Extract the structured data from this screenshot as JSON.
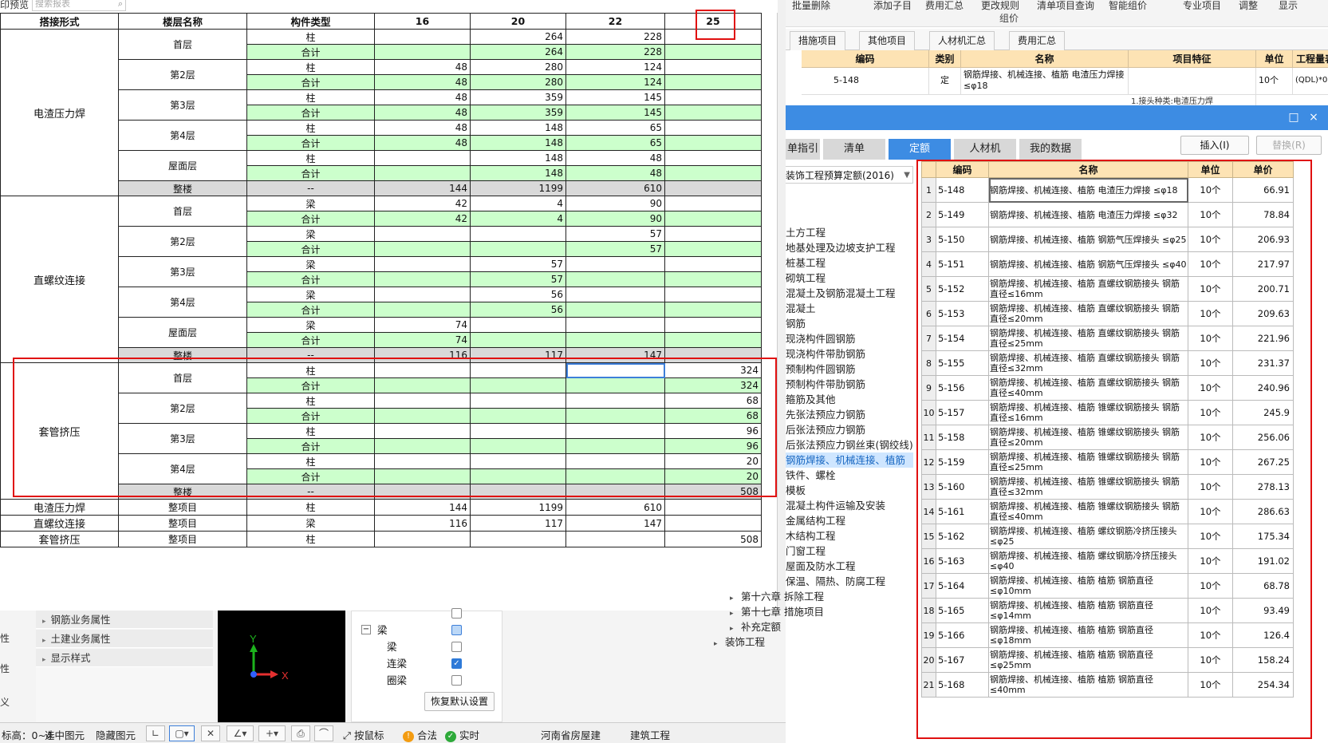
{
  "ribbon": {
    "items": [
      "批量删除",
      "添加子目",
      "费用汇总",
      "更改规则",
      "清单项目查询",
      "智能组价",
      "专业项目",
      "调整",
      "显示"
    ],
    "group_label": "组价"
  },
  "tabs": [
    "措施项目",
    "其他项目",
    "人材机汇总",
    "费用汇总"
  ],
  "bg_grid": {
    "headers": [
      "编码",
      "类别",
      "名称",
      "项目特征",
      "单位",
      "工程量表"
    ],
    "row": {
      "code": "5-148",
      "type": "定",
      "name": "钢筋焊接、机械连接、植筋 电渣压力焊接 ≤φ18",
      "unit": "10个",
      "qty": "(QDL)*0"
    },
    "row2_feature": "1.接头种类:电渣压力焊"
  },
  "dialog": {
    "controls": [
      "□",
      "×"
    ],
    "tabs": [
      "单指引",
      "清单",
      "定额",
      "人材机",
      "我的数据"
    ],
    "active_tab": "定额",
    "insert_button": "插入(I)",
    "replace_button": "替换(R)",
    "quota_set": "装饰工程预算定额(2016)",
    "tree": [
      {
        "label": "土方工程",
        "sel": false
      },
      {
        "label": "地基处理及边坡支护工程",
        "sel": false
      },
      {
        "label": "桩基工程",
        "sel": false
      },
      {
        "label": "砌筑工程",
        "sel": false
      },
      {
        "label": "混凝土及钢筋混凝土工程",
        "sel": false
      },
      {
        "label": "混凝土",
        "sel": false
      },
      {
        "label": "钢筋",
        "sel": false
      },
      {
        "label": "现浇构件圆钢筋",
        "sel": false
      },
      {
        "label": "现浇构件带肋钢筋",
        "sel": false
      },
      {
        "label": "预制构件圆钢筋",
        "sel": false
      },
      {
        "label": "预制构件带肋钢筋",
        "sel": false
      },
      {
        "label": "箍筋及其他",
        "sel": false
      },
      {
        "label": "先张法预应力钢筋",
        "sel": false
      },
      {
        "label": "后张法预应力钢筋",
        "sel": false
      },
      {
        "label": "后张法预应力钢丝束(钢绞线)",
        "sel": false
      },
      {
        "label": "钢筋焊接、机械连接、植筋",
        "sel": true
      },
      {
        "label": "铁件、螺栓",
        "sel": false
      },
      {
        "label": "模板",
        "sel": false
      },
      {
        "label": "混凝土构件运输及安装",
        "sel": false
      },
      {
        "label": "金属结构工程",
        "sel": false
      },
      {
        "label": "木结构工程",
        "sel": false
      },
      {
        "label": "门窗工程",
        "sel": false
      },
      {
        "label": "屋面及防水工程",
        "sel": false
      },
      {
        "label": "保温、隔热、防腐工程",
        "sel": false
      },
      {
        "label": "第十六章 拆除工程",
        "sel": false,
        "arrow": "▸"
      },
      {
        "label": "第十七章 措施项目",
        "sel": false,
        "arrow": "▸"
      },
      {
        "label": "补充定额",
        "sel": false,
        "arrow": "▸"
      },
      {
        "label": "装饰工程",
        "sel": false,
        "arrow": "▸",
        "outer": true
      }
    ]
  },
  "quota_table": {
    "headers": [
      "编码",
      "名称",
      "单位",
      "单价"
    ],
    "rows": [
      {
        "no": "1",
        "code": "5-148",
        "name": "钢筋焊接、机械连接、植筋 电渣压力焊接 ≤φ18",
        "unit": "10个",
        "price": "66.91"
      },
      {
        "no": "2",
        "code": "5-149",
        "name": "钢筋焊接、机械连接、植筋 电渣压力焊接 ≤φ32",
        "unit": "10个",
        "price": "78.84"
      },
      {
        "no": "3",
        "code": "5-150",
        "name": "钢筋焊接、机械连接、植筋 钢筋气压焊接头 ≤φ25",
        "unit": "10个",
        "price": "206.93"
      },
      {
        "no": "4",
        "code": "5-151",
        "name": "钢筋焊接、机械连接、植筋 钢筋气压焊接头 ≤φ40",
        "unit": "10个",
        "price": "217.97"
      },
      {
        "no": "5",
        "code": "5-152",
        "name": "钢筋焊接、机械连接、植筋 直螺纹钢筋接头 钢筋直径≤16mm",
        "unit": "10个",
        "price": "200.71"
      },
      {
        "no": "6",
        "code": "5-153",
        "name": "钢筋焊接、机械连接、植筋 直螺纹钢筋接头 钢筋直径≤20mm",
        "unit": "10个",
        "price": "209.63"
      },
      {
        "no": "7",
        "code": "5-154",
        "name": "钢筋焊接、机械连接、植筋 直螺纹钢筋接头 钢筋直径≤25mm",
        "unit": "10个",
        "price": "221.96"
      },
      {
        "no": "8",
        "code": "5-155",
        "name": "钢筋焊接、机械连接、植筋 直螺纹钢筋接头 钢筋直径≤32mm",
        "unit": "10个",
        "price": "231.37"
      },
      {
        "no": "9",
        "code": "5-156",
        "name": "钢筋焊接、机械连接、植筋 直螺纹钢筋接头 钢筋直径≤40mm",
        "unit": "10个",
        "price": "240.96"
      },
      {
        "no": "10",
        "code": "5-157",
        "name": "钢筋焊接、机械连接、植筋 锥螺纹钢筋接头 钢筋直径≤16mm",
        "unit": "10个",
        "price": "245.9"
      },
      {
        "no": "11",
        "code": "5-158",
        "name": "钢筋焊接、机械连接、植筋 锥螺纹钢筋接头 钢筋直径≤20mm",
        "unit": "10个",
        "price": "256.06"
      },
      {
        "no": "12",
        "code": "5-159",
        "name": "钢筋焊接、机械连接、植筋 锥螺纹钢筋接头 钢筋直径≤25mm",
        "unit": "10个",
        "price": "267.25"
      },
      {
        "no": "13",
        "code": "5-160",
        "name": "钢筋焊接、机械连接、植筋 锥螺纹钢筋接头 钢筋直径≤32mm",
        "unit": "10个",
        "price": "278.13"
      },
      {
        "no": "14",
        "code": "5-161",
        "name": "钢筋焊接、机械连接、植筋 锥螺纹钢筋接头 钢筋直径≤40mm",
        "unit": "10个",
        "price": "286.63"
      },
      {
        "no": "15",
        "code": "5-162",
        "name": "钢筋焊接、机械连接、植筋 螺纹钢筋冷挤压接头 ≤φ25",
        "unit": "10个",
        "price": "175.34"
      },
      {
        "no": "16",
        "code": "5-163",
        "name": "钢筋焊接、机械连接、植筋 螺纹钢筋冷挤压接头 ≤φ40",
        "unit": "10个",
        "price": "191.02"
      },
      {
        "no": "17",
        "code": "5-164",
        "name": "钢筋焊接、机械连接、植筋 植筋 钢筋直径 ≤φ10mm",
        "unit": "10个",
        "price": "68.78"
      },
      {
        "no": "18",
        "code": "5-165",
        "name": "钢筋焊接、机械连接、植筋 植筋 钢筋直径 ≤φ14mm",
        "unit": "10个",
        "price": "93.49"
      },
      {
        "no": "19",
        "code": "5-166",
        "name": "钢筋焊接、机械连接、植筋 植筋 钢筋直径 ≤φ18mm",
        "unit": "10个",
        "price": "126.4"
      },
      {
        "no": "20",
        "code": "5-167",
        "name": "钢筋焊接、机械连接、植筋 植筋 钢筋直径 ≤φ25mm",
        "unit": "10个",
        "price": "158.24"
      },
      {
        "no": "21",
        "code": "5-168",
        "name": "钢筋焊接、机械连接、植筋 植筋 钢筋直径 ≤40mm",
        "unit": "10个",
        "price": "254.34"
      }
    ]
  },
  "report": {
    "preview_label": "印预览",
    "search_placeholder": "搜索报表",
    "headers": [
      "搭接形式",
      "楼层名称",
      "构件类型",
      "16",
      "20",
      "22",
      "25"
    ],
    "groups": [
      {
        "name": "电渣压力焊",
        "floors": [
          {
            "floor": "首层",
            "type": "柱",
            "v": [
              "",
              "264",
              "228",
              ""
            ],
            "t": [
              "",
              "264",
              "228",
              ""
            ]
          },
          {
            "floor": "第2层",
            "type": "柱",
            "v": [
              "48",
              "280",
              "124",
              ""
            ],
            "t": [
              "48",
              "280",
              "124",
              ""
            ]
          },
          {
            "floor": "第3层",
            "type": "柱",
            "v": [
              "48",
              "359",
              "145",
              ""
            ],
            "t": [
              "48",
              "359",
              "145",
              ""
            ]
          },
          {
            "floor": "第4层",
            "type": "柱",
            "v": [
              "48",
              "148",
              "65",
              ""
            ],
            "t": [
              "48",
              "148",
              "65",
              ""
            ]
          },
          {
            "floor": "屋面层",
            "type": "柱",
            "v": [
              "",
              "148",
              "48",
              ""
            ],
            "t": [
              "",
              "148",
              "48",
              ""
            ]
          }
        ],
        "whole": [
          "144",
          "1199",
          "610",
          ""
        ]
      },
      {
        "name": "直螺纹连接",
        "floors": [
          {
            "floor": "首层",
            "type": "梁",
            "v": [
              "42",
              "4",
              "90",
              ""
            ],
            "t": [
              "42",
              "4",
              "90",
              ""
            ]
          },
          {
            "floor": "第2层",
            "type": "梁",
            "v": [
              "",
              "",
              "57",
              ""
            ],
            "t": [
              "",
              "",
              "57",
              ""
            ]
          },
          {
            "floor": "第3层",
            "type": "梁",
            "v": [
              "",
              "57",
              "",
              ""
            ],
            "t": [
              "",
              "57",
              "",
              ""
            ]
          },
          {
            "floor": "第4层",
            "type": "梁",
            "v": [
              "",
              "56",
              "",
              ""
            ],
            "t": [
              "",
              "56",
              "",
              ""
            ]
          },
          {
            "floor": "屋面层",
            "type": "梁",
            "v": [
              "74",
              "",
              "",
              ""
            ],
            "t": [
              "74",
              "",
              "",
              ""
            ]
          }
        ],
        "whole": [
          "116",
          "117",
          "147",
          ""
        ]
      },
      {
        "name": "套管挤压",
        "floors": [
          {
            "floor": "首层",
            "type": "柱",
            "v": [
              "",
              "",
              "",
              "324"
            ],
            "t": [
              "",
              "",
              "",
              "324"
            ]
          },
          {
            "floor": "第2层",
            "type": "柱",
            "v": [
              "",
              "",
              "",
              "68"
            ],
            "t": [
              "",
              "",
              "",
              "68"
            ]
          },
          {
            "floor": "第3层",
            "type": "柱",
            "v": [
              "",
              "",
              "",
              "96"
            ],
            "t": [
              "",
              "",
              "",
              "96"
            ]
          },
          {
            "floor": "第4层",
            "type": "柱",
            "v": [
              "",
              "",
              "",
              "20"
            ],
            "t": [
              "",
              "",
              "",
              "20"
            ]
          }
        ],
        "whole": [
          "",
          "",
          "",
          "508"
        ]
      }
    ],
    "total_label": "合计",
    "whole_label": "整楼",
    "whole_type": "--",
    "summary": [
      {
        "name": "电渣压力焊",
        "floor": "整项目",
        "type": "柱",
        "v": [
          "144",
          "1199",
          "610",
          ""
        ]
      },
      {
        "name": "直螺纹连接",
        "floor": "整项目",
        "type": "梁",
        "v": [
          "116",
          "117",
          "147",
          ""
        ]
      },
      {
        "name": "套管挤压",
        "floor": "整项目",
        "type": "柱",
        "v": [
          "",
          "",
          "",
          "508"
        ]
      }
    ]
  },
  "bottom": {
    "left_stub": [
      "性",
      "性",
      "义"
    ],
    "props": [
      "钢筋业务属性",
      "土建业务属性",
      "显示样式"
    ],
    "axis_y": "Y",
    "axis_x": "X",
    "layers": [
      {
        "label": "",
        "indent": true,
        "state": "off"
      },
      {
        "label": "梁",
        "indent": false,
        "state": "partial",
        "expander": "−"
      },
      {
        "label": "梁",
        "indent": true,
        "state": "off"
      },
      {
        "label": "连梁",
        "indent": true,
        "state": "on"
      },
      {
        "label": "圈梁",
        "indent": true,
        "state": "off"
      }
    ],
    "restore_button": "恢复默认设置"
  },
  "status": {
    "elev": "标高：0~4",
    "select_label": "选中图元",
    "hide_label": "隐藏图元",
    "snap_label": "按鼠标",
    "legal_label": "合法",
    "realtime_label": "实时",
    "region": "河南省房屋建",
    "discipline": "建筑工程"
  }
}
